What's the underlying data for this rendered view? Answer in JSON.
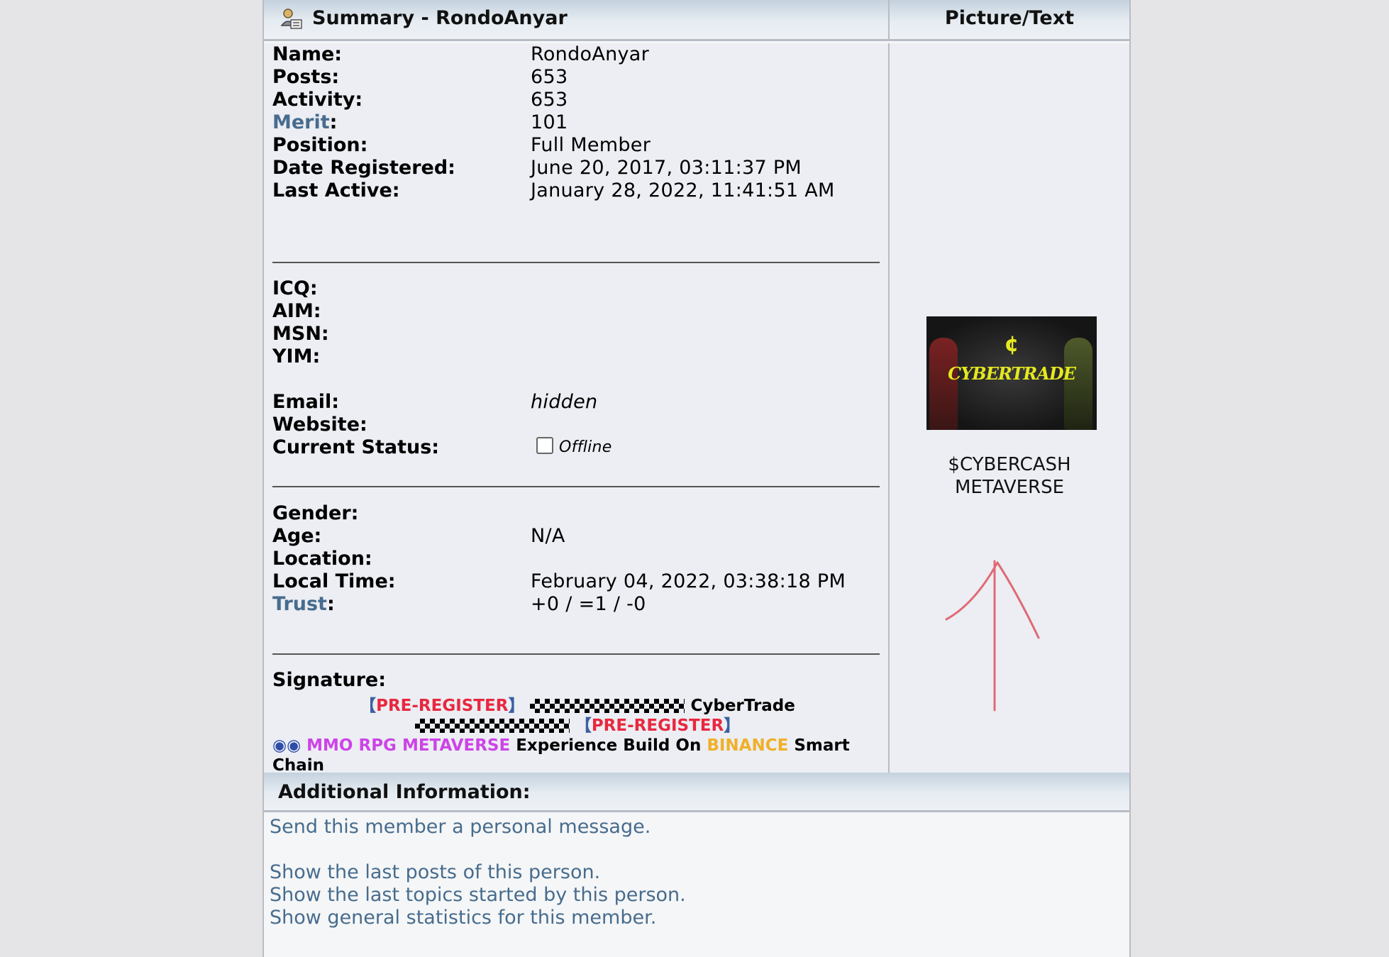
{
  "header": {
    "summary_title": "Summary - RondoAnyar",
    "picture_title": "Picture/Text"
  },
  "fields": {
    "name_label": "Name:",
    "name_value": "RondoAnyar",
    "posts_label": "Posts:",
    "posts_value": "653",
    "activity_label": "Activity:",
    "activity_value": "653",
    "merit_label": "Merit",
    "merit_value": "101",
    "position_label": "Position:",
    "position_value": "Full Member",
    "registered_label": "Date Registered:",
    "registered_value": "June 20, 2017, 03:11:37 PM",
    "last_active_label": "Last Active:",
    "last_active_value": "January 28, 2022, 11:41:51 AM",
    "icq_label": "ICQ:",
    "aim_label": "AIM:",
    "msn_label": "MSN:",
    "yim_label": "YIM:",
    "email_label": "Email:",
    "email_value": "hidden",
    "website_label": "Website:",
    "status_label": "Current Status:",
    "status_value": "Offline",
    "gender_label": "Gender:",
    "age_label": "Age:",
    "age_value": "N/A",
    "location_label": "Location:",
    "local_time_label": "Local Time:",
    "local_time_value": "February 04, 2022, 03:38:18 PM",
    "trust_label": "Trust",
    "trust_value": "+0 / =1 / -0",
    "signature_label": "Signature:"
  },
  "signature": {
    "bracket_open": "【",
    "bracket_close": "】",
    "pre_register": "PRE-REGISTER",
    "cybertrade": "CyberTrade",
    "dots": "◉◉",
    "mmo": "MMO RPG METAVERSE",
    "experience": "Experience Build On",
    "binance": "BINANCE",
    "smart_chain": "Smart Chain"
  },
  "picture": {
    "banner_mark": "¢",
    "banner_logo": "CYBERTRADE",
    "text_line1": "$CYBERCASH",
    "text_line2": "METAVERSE"
  },
  "additional": {
    "title": "Additional Information:",
    "send_pm": "Send this member a personal message.",
    "last_posts": "Show the last posts of this person.",
    "last_topics": "Show the last topics started by this person.",
    "general_stats": "Show general statistics for this member."
  },
  "colors": {
    "link_blue": "#476c8e",
    "signature_red": "#e8283f",
    "signature_purple": "#cc44e6",
    "signature_gold": "#f0b02a",
    "banner_yellow": "#e4e820",
    "arrow_red": "#e06a75"
  }
}
